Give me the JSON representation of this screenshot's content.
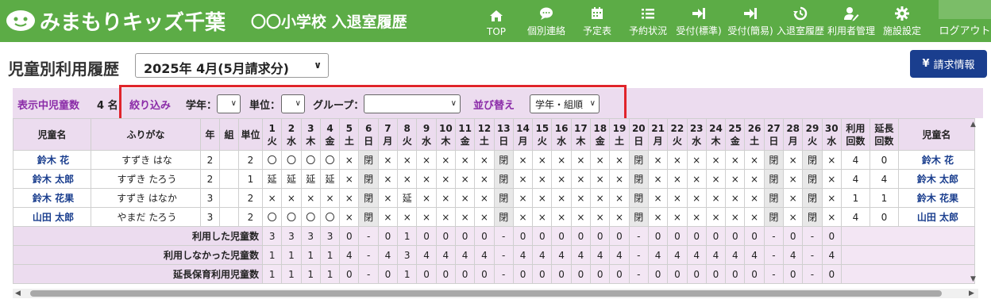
{
  "header": {
    "logo_text": "みまもりキッズ千葉",
    "school_title": "〇〇小学校 入退室履歴",
    "nav": [
      {
        "label": "TOP",
        "icon": "home-icon"
      },
      {
        "label": "個別連絡",
        "icon": "chat-icon"
      },
      {
        "label": "予定表",
        "icon": "calendar-icon"
      },
      {
        "label": "予約状況",
        "icon": "list-icon"
      },
      {
        "label": "受付(標準)",
        "icon": "sign-in-icon"
      },
      {
        "label": "受付(簡易)",
        "icon": "sign-in-icon"
      },
      {
        "label": "入退室履歴",
        "icon": "history-icon"
      },
      {
        "label": "利用者管理",
        "icon": "user-edit-icon"
      },
      {
        "label": "施設設定",
        "icon": "gear-icon"
      }
    ],
    "logout": "ログアウト"
  },
  "page": {
    "title": "児童別利用履歴",
    "month_select": "2025年 4月(5月請求分)",
    "billing_button": "請求情報",
    "billing_icon": "yen-icon"
  },
  "filter": {
    "count_label": "表示中児童数",
    "count_value": "4 名",
    "filter_label": "絞り込み",
    "grade_label": "学年：",
    "unit_label": "単位：",
    "group_label": "グループ：",
    "sort_label": "並び替え",
    "sort_value": "学年・組順"
  },
  "table": {
    "headers": {
      "name": "児童名",
      "kana": "ふりがな",
      "grade": "年",
      "class": "組",
      "unit": "単位",
      "use_count": "利用回数",
      "ext_count": "延長回数",
      "name_right": "児童名"
    },
    "days": [
      "1",
      "2",
      "3",
      "4",
      "5",
      "6",
      "7",
      "8",
      "9",
      "10",
      "11",
      "12",
      "13",
      "14",
      "15",
      "16",
      "17",
      "18",
      "19",
      "20",
      "21",
      "22",
      "23",
      "24",
      "25",
      "26",
      "27",
      "28",
      "29",
      "30"
    ],
    "weekdays": [
      "火",
      "水",
      "木",
      "金",
      "土",
      "日",
      "月",
      "火",
      "水",
      "木",
      "金",
      "土",
      "日",
      "月",
      "火",
      "水",
      "木",
      "金",
      "土",
      "日",
      "月",
      "火",
      "水",
      "木",
      "金",
      "土",
      "日",
      "月",
      "火",
      "水"
    ],
    "closed_label": "閉",
    "rows": [
      {
        "name": "鈴木 花",
        "kana": "すずき はな",
        "grade": "2",
        "class": "",
        "unit": "2",
        "marks": [
          "〇",
          "〇",
          "〇",
          "〇",
          "×",
          "閉",
          "×",
          "×",
          "×",
          "×",
          "×",
          "×",
          "閉",
          "×",
          "×",
          "×",
          "×",
          "×",
          "×",
          "閉",
          "×",
          "×",
          "×",
          "×",
          "×",
          "×",
          "閉",
          "×",
          "閉",
          "×"
        ],
        "use": "4",
        "ext": "0"
      },
      {
        "name": "鈴木 太郎",
        "kana": "すずき たろう",
        "grade": "2",
        "class": "",
        "unit": "1",
        "marks": [
          "延",
          "延",
          "延",
          "延",
          "×",
          "閉",
          "×",
          "×",
          "×",
          "×",
          "×",
          "×",
          "閉",
          "×",
          "×",
          "×",
          "×",
          "×",
          "×",
          "閉",
          "×",
          "×",
          "×",
          "×",
          "×",
          "×",
          "閉",
          "×",
          "閉",
          "×"
        ],
        "use": "4",
        "ext": "4"
      },
      {
        "name": "鈴木 花果",
        "kana": "すずき はなか",
        "grade": "3",
        "class": "",
        "unit": "2",
        "marks": [
          "×",
          "×",
          "×",
          "×",
          "×",
          "閉",
          "×",
          "延",
          "×",
          "×",
          "×",
          "×",
          "閉",
          "×",
          "×",
          "×",
          "×",
          "×",
          "×",
          "閉",
          "×",
          "×",
          "×",
          "×",
          "×",
          "×",
          "閉",
          "×",
          "閉",
          "×"
        ],
        "use": "1",
        "ext": "1"
      },
      {
        "name": "山田 太郎",
        "kana": "やまだ たろう",
        "grade": "3",
        "class": "",
        "unit": "2",
        "marks": [
          "〇",
          "〇",
          "〇",
          "〇",
          "×",
          "閉",
          "×",
          "×",
          "×",
          "×",
          "×",
          "×",
          "閉",
          "×",
          "×",
          "×",
          "×",
          "×",
          "×",
          "閉",
          "×",
          "×",
          "×",
          "×",
          "×",
          "×",
          "閉",
          "×",
          "閉",
          "×"
        ],
        "use": "4",
        "ext": "0"
      }
    ],
    "summary": [
      {
        "label": "利用した児童数",
        "values": [
          "3",
          "3",
          "3",
          "3",
          "0",
          "-",
          "0",
          "1",
          "0",
          "0",
          "0",
          "0",
          "-",
          "0",
          "0",
          "0",
          "0",
          "0",
          "0",
          "-",
          "0",
          "0",
          "0",
          "0",
          "0",
          "0",
          "-",
          "0",
          "-",
          "0"
        ]
      },
      {
        "label": "利用しなかった児童数",
        "values": [
          "1",
          "1",
          "1",
          "1",
          "4",
          "-",
          "4",
          "3",
          "4",
          "4",
          "4",
          "4",
          "-",
          "4",
          "4",
          "4",
          "4",
          "4",
          "4",
          "-",
          "4",
          "4",
          "4",
          "4",
          "4",
          "4",
          "-",
          "4",
          "-",
          "4"
        ]
      },
      {
        "label": "延長保育利用児童数",
        "values": [
          "1",
          "1",
          "1",
          "1",
          "0",
          "-",
          "0",
          "1",
          "0",
          "0",
          "0",
          "0",
          "-",
          "0",
          "0",
          "0",
          "0",
          "0",
          "0",
          "-",
          "0",
          "0",
          "0",
          "0",
          "0",
          "0",
          "-",
          "0",
          "-",
          "0"
        ]
      }
    ]
  }
}
